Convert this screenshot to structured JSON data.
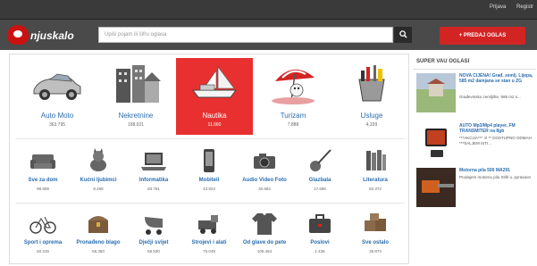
{
  "topbar": {
    "links": [
      "Prijava",
      "Registr"
    ]
  },
  "header": {
    "logo_text": "njuskalo",
    "search_placeholder": "Upiši pojam ili šifru oglasa",
    "search_icon": "search-icon",
    "post_button": "+ PREDAJ OGLAS"
  },
  "main": {
    "featured": [
      {
        "label": "Auto Moto",
        "count": "363.795",
        "icon": "car-icon"
      },
      {
        "label": "Nekretnine",
        "count": "168.021",
        "icon": "buildings-icon"
      },
      {
        "label": "Nautika",
        "count": "11.660",
        "icon": "boat-icon",
        "active": true
      },
      {
        "label": "Turizam",
        "count": "7.888",
        "icon": "beach-umbrella-icon"
      },
      {
        "label": "Usluge",
        "count": "4.339",
        "icon": "tools-icon"
      }
    ],
    "row2": [
      {
        "label": "Sve za dom",
        "count": "99.808",
        "icon": "sofa-icon"
      },
      {
        "label": "Kućni ljubimci",
        "count": "8.468",
        "icon": "pet-icon"
      },
      {
        "label": "Informatika",
        "count": "83.791",
        "icon": "laptop-icon"
      },
      {
        "label": "Mobiteli",
        "count": "43.823",
        "icon": "phone-icon"
      },
      {
        "label": "Audio Video Foto",
        "count": "30.683",
        "icon": "camera-icon"
      },
      {
        "label": "Glazbala",
        "count": "17.686",
        "icon": "guitar-icon"
      },
      {
        "label": "Literatura",
        "count": "92.372",
        "icon": "books-icon"
      }
    ],
    "row3": [
      {
        "label": "Sport i oprema",
        "count": "50.319",
        "icon": "bicycle-icon"
      },
      {
        "label": "Pronađeno blago",
        "count": "55.350",
        "icon": "treasure-icon"
      },
      {
        "label": "Dječji svijet",
        "count": "58.530",
        "icon": "stroller-icon"
      },
      {
        "label": "Strojevi i alati",
        "count": "75.049",
        "icon": "machine-icon"
      },
      {
        "label": "Od glave do pete",
        "count": "105.464",
        "icon": "clothes-icon"
      },
      {
        "label": "Poslovi",
        "count": "1.436",
        "icon": "briefcase-icon"
      },
      {
        "label": "Sve ostalo",
        "count": "35.873",
        "icon": "boxes-icon"
      }
    ]
  },
  "sidebar": {
    "title": "SUPER VAU OGLASI",
    "ads": [
      {
        "title": "NOVA CIJENA! Građ. zemlj. Lijepa, 585 m2 damjana se stan u ZG",
        "desc": "Građevinsko zemljište, 595 m2 s..."
      },
      {
        "title": "AUTO Mp3/Mp4 player, FM TRANSMITER na 8gb",
        "desc": "***AKCIJA*** !!! ** DOSTUPNO ODMAH ***ŠALJEM ISTI..."
      },
      {
        "title": "Motorna pila 500 MA291",
        "desc": "Prodajem motornu pilu Stihl u. pyrasaon"
      }
    ]
  },
  "colors": {
    "accent": "#e83030",
    "link": "#2a6db0",
    "header": "#4a4a4a"
  }
}
